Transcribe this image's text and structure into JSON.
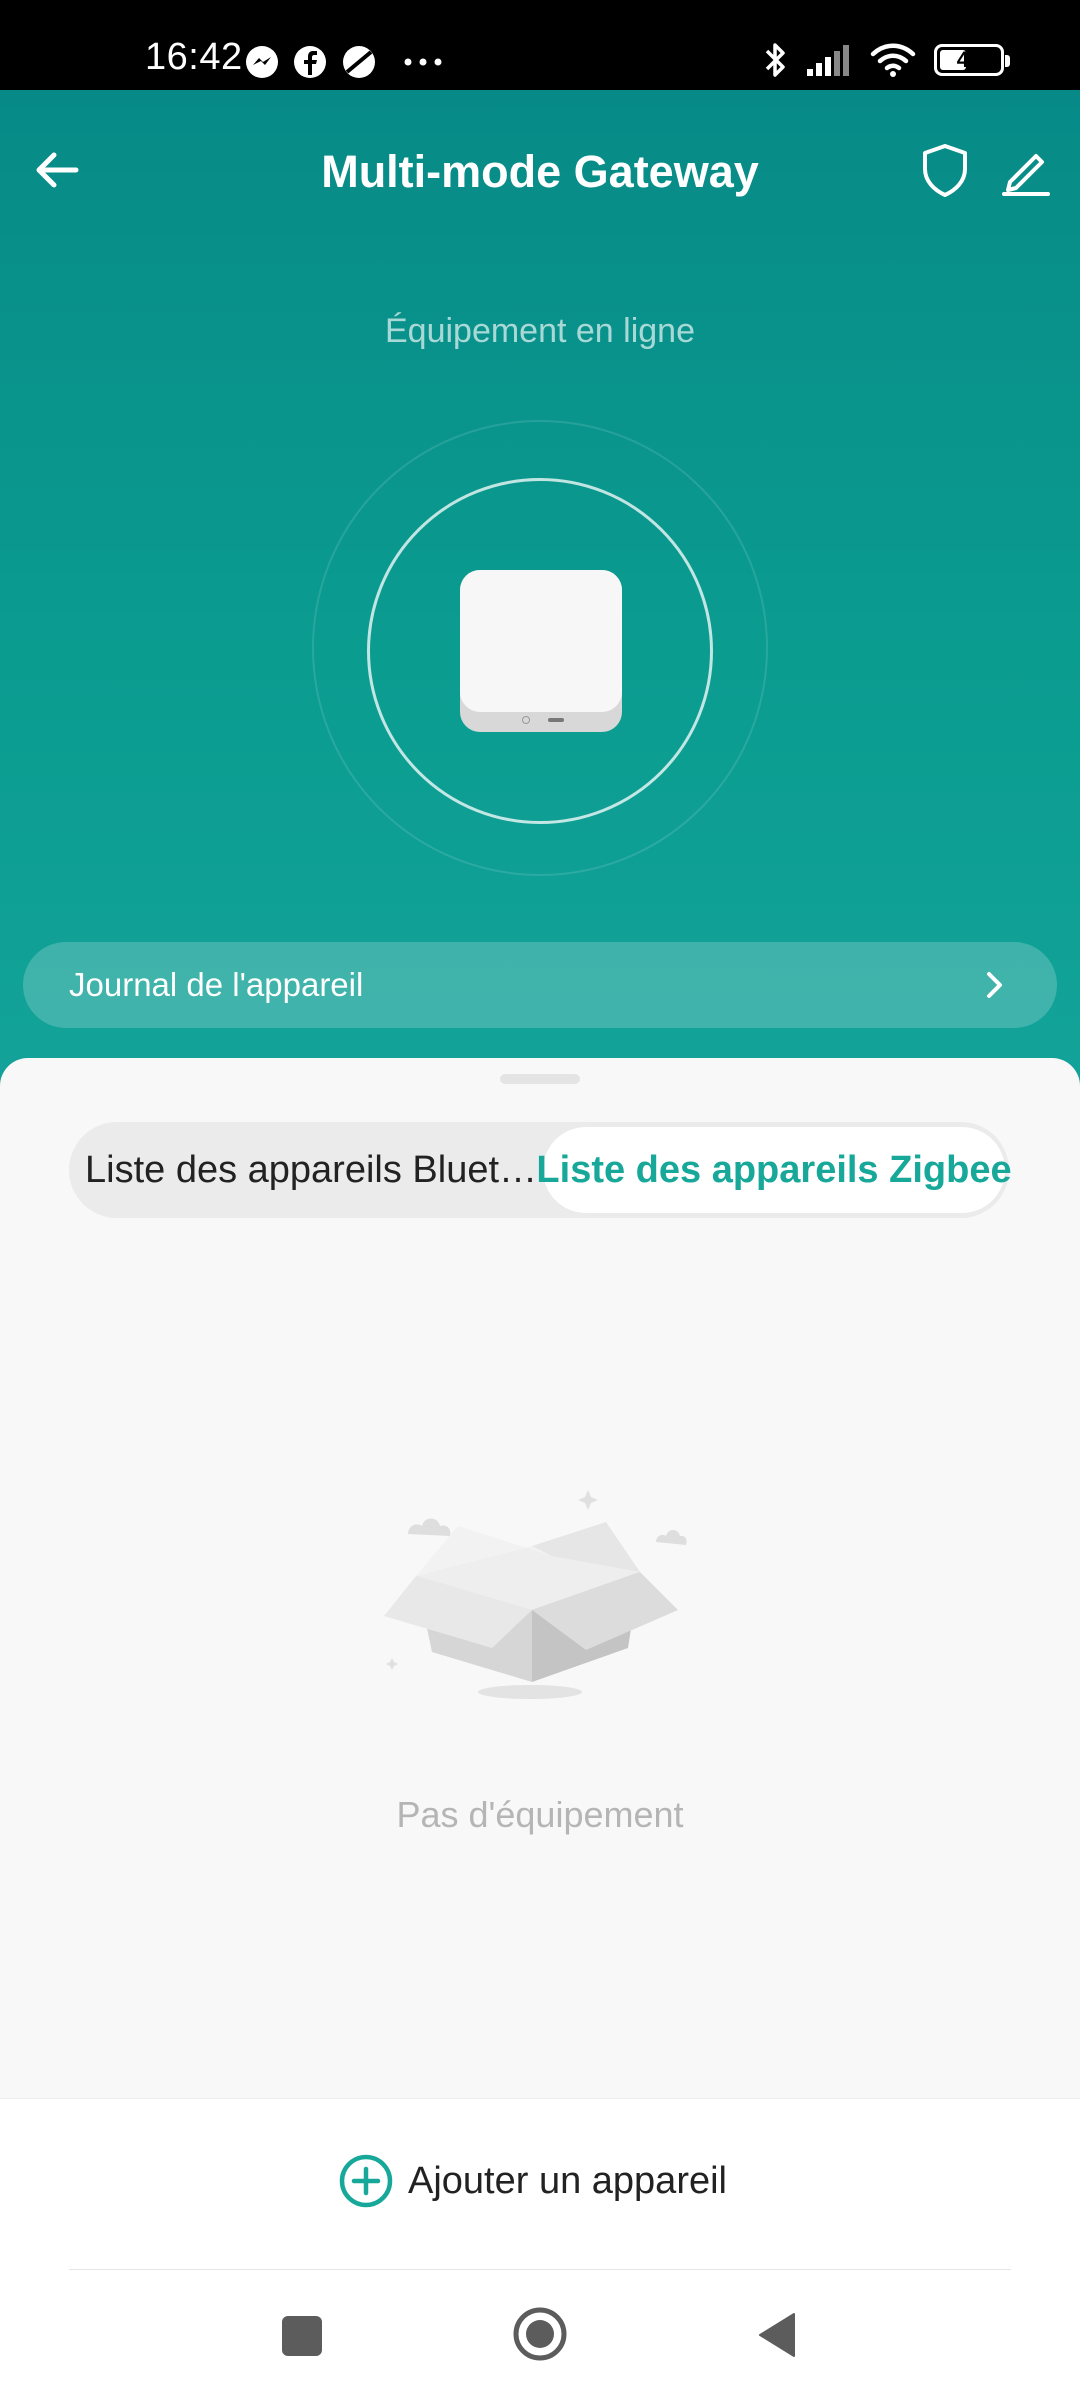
{
  "status_bar": {
    "time": "16:42",
    "battery_level": "44",
    "battery_fraction": 0.44,
    "left_icons": [
      "messenger-icon",
      "facebook-icon",
      "no-sync-icon",
      "more-dots-icon"
    ],
    "right_icons": [
      "bluetooth-icon",
      "signal-icon",
      "wifi-icon",
      "battery-icon"
    ]
  },
  "header": {
    "title": "Multi-mode Gateway",
    "online_status": "Équipement en ligne",
    "accent_color": "#0b9c90"
  },
  "device_log": {
    "label": "Journal de l'appareil"
  },
  "tabs": {
    "bluetooth_label": "Liste des appareils Bluet…",
    "zigbee_label": "Liste des appareils Zigbee",
    "selected": "zigbee",
    "selected_color": "#17a899"
  },
  "empty_state": {
    "message": "Pas d'équipement"
  },
  "add_device": {
    "label": "Ajouter un appareil"
  }
}
